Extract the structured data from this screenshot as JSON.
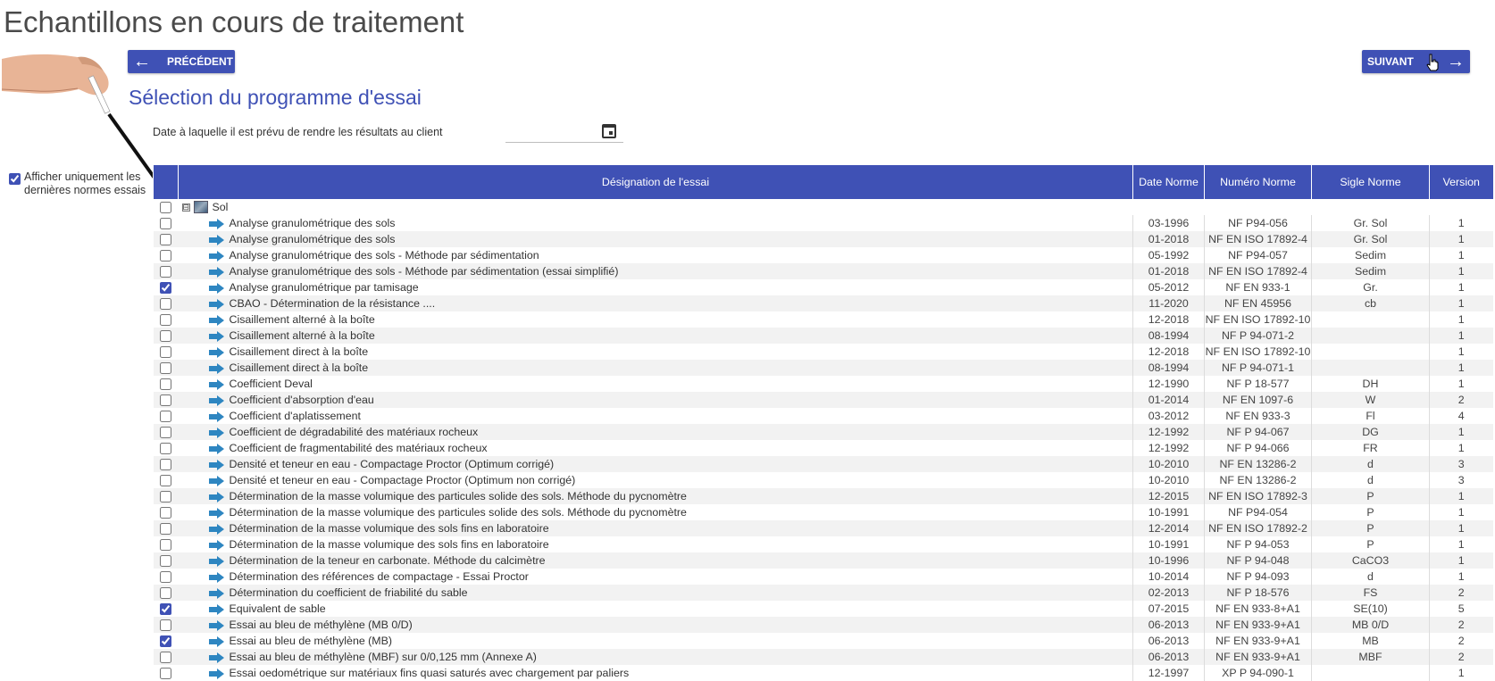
{
  "page": {
    "title": "Echantillons en cours de traitement"
  },
  "nav": {
    "prev_label": "PRÉCÉDENT",
    "next_label": "SUIVANT"
  },
  "section": {
    "title": "Sélection du programme d'essai"
  },
  "date_field": {
    "label": "Date à laquelle il est prévu de rendre les résultats au client",
    "value": ""
  },
  "filter": {
    "label_line1": "Afficher uniquement les",
    "label_line2": "dernières normes essais",
    "checked": true
  },
  "table": {
    "headers": {
      "designation": "Désignation de l'essai",
      "date": "Date Norme",
      "numero": "Numéro Norme",
      "sigle": "Sigle Norme",
      "version": "Version"
    },
    "group": {
      "label": "Sol",
      "toggle": "⊟"
    },
    "rows": [
      {
        "name": "Analyse granulométrique des sols",
        "date": "03-1996",
        "numero": "NF P94-056",
        "sigle": "Gr. Sol",
        "version": "1",
        "checked": false
      },
      {
        "name": "Analyse granulométrique des sols",
        "date": "01-2018",
        "numero": "NF EN ISO 17892-4",
        "sigle": "Gr. Sol",
        "version": "1",
        "checked": false
      },
      {
        "name": "Analyse granulométrique des sols - Méthode par sédimentation",
        "date": "05-1992",
        "numero": "NF P94-057",
        "sigle": "Sedim",
        "version": "1",
        "checked": false
      },
      {
        "name": "Analyse granulométrique des sols - Méthode par sédimentation (essai simplifié)",
        "date": "01-2018",
        "numero": "NF EN ISO 17892-4",
        "sigle": "Sedim",
        "version": "1",
        "checked": false
      },
      {
        "name": "Analyse granulométrique par tamisage",
        "date": "05-2012",
        "numero": "NF EN 933-1",
        "sigle": "Gr.",
        "version": "1",
        "checked": true
      },
      {
        "name": "CBAO - Détermination de la résistance ....",
        "date": "11-2020",
        "numero": "NF EN 45956",
        "sigle": "cb",
        "version": "1",
        "checked": false
      },
      {
        "name": "Cisaillement alterné à la boîte",
        "date": "12-2018",
        "numero": "NF EN ISO 17892-10",
        "sigle": "",
        "version": "1",
        "checked": false
      },
      {
        "name": "Cisaillement alterné à la boîte",
        "date": "08-1994",
        "numero": "NF P 94-071-2",
        "sigle": "",
        "version": "1",
        "checked": false
      },
      {
        "name": "Cisaillement direct à la boîte",
        "date": "12-2018",
        "numero": "NF EN ISO 17892-10",
        "sigle": "",
        "version": "1",
        "checked": false
      },
      {
        "name": "Cisaillement direct à la boîte",
        "date": "08-1994",
        "numero": "NF P 94-071-1",
        "sigle": "",
        "version": "1",
        "checked": false
      },
      {
        "name": "Coefficient Deval",
        "date": "12-1990",
        "numero": "NF P 18-577",
        "sigle": "DH",
        "version": "1",
        "checked": false
      },
      {
        "name": "Coefficient d'absorption d'eau",
        "date": "01-2014",
        "numero": "NF EN 1097-6",
        "sigle": "W",
        "version": "2",
        "checked": false
      },
      {
        "name": "Coefficient d'aplatissement",
        "date": "03-2012",
        "numero": "NF EN 933-3",
        "sigle": "Fl",
        "version": "4",
        "checked": false
      },
      {
        "name": "Coefficient de dégradabilité des matériaux rocheux",
        "date": "12-1992",
        "numero": "NF P 94-067",
        "sigle": "DG",
        "version": "1",
        "checked": false
      },
      {
        "name": "Coefficient de fragmentabilité des matériaux rocheux",
        "date": "12-1992",
        "numero": "NF P 94-066",
        "sigle": "FR",
        "version": "1",
        "checked": false
      },
      {
        "name": "Densité et teneur en eau - Compactage Proctor (Optimum corrigé)",
        "date": "10-2010",
        "numero": "NF EN 13286-2",
        "sigle": "d",
        "version": "3",
        "checked": false
      },
      {
        "name": "Densité et teneur en eau - Compactage Proctor (Optimum non corrigé)",
        "date": "10-2010",
        "numero": "NF EN 13286-2",
        "sigle": "d",
        "version": "3",
        "checked": false
      },
      {
        "name": "Détermination de la masse volumique des particules solide des sols. Méthode du pycnomètre",
        "date": "12-2015",
        "numero": "NF EN ISO 17892-3",
        "sigle": "P",
        "version": "1",
        "checked": false
      },
      {
        "name": "Détermination de la masse volumique des particules solide des sols. Méthode du pycnomètre",
        "date": "10-1991",
        "numero": "NF P94-054",
        "sigle": "P",
        "version": "1",
        "checked": false
      },
      {
        "name": "Détermination de la masse volumique des sols fins en laboratoire",
        "date": "12-2014",
        "numero": "NF EN ISO 17892-2",
        "sigle": "P",
        "version": "1",
        "checked": false
      },
      {
        "name": "Détermination de la masse volumique des sols fins en laboratoire",
        "date": "10-1991",
        "numero": "NF P 94-053",
        "sigle": "P",
        "version": "1",
        "checked": false
      },
      {
        "name": "Détermination de la teneur en carbonate. Méthode du calcimètre",
        "date": "10-1996",
        "numero": "NF P 94-048",
        "sigle": "CaCO3",
        "version": "1",
        "checked": false
      },
      {
        "name": "Détermination des références de compactage - Essai Proctor",
        "date": "10-2014",
        "numero": "NF P 94-093",
        "sigle": "d",
        "version": "1",
        "checked": false
      },
      {
        "name": "Détermination du coefficient de friabilité du sable",
        "date": "02-2013",
        "numero": "NF P 18-576",
        "sigle": "FS",
        "version": "2",
        "checked": false
      },
      {
        "name": "Equivalent de sable",
        "date": "07-2015",
        "numero": "NF EN 933-8+A1",
        "sigle": "SE(10)",
        "version": "5",
        "checked": true
      },
      {
        "name": "Essai au bleu de méthylène (MB 0/D)",
        "date": "06-2013",
        "numero": "NF EN 933-9+A1",
        "sigle": "MB 0/D",
        "version": "2",
        "checked": false
      },
      {
        "name": "Essai au bleu de méthylène (MB)",
        "date": "06-2013",
        "numero": "NF EN 933-9+A1",
        "sigle": "MB",
        "version": "2",
        "checked": true
      },
      {
        "name": "Essai au bleu de méthylène (MBF) sur 0/0,125 mm (Annexe A)",
        "date": "06-2013",
        "numero": "NF EN 933-9+A1",
        "sigle": "MBF",
        "version": "2",
        "checked": false
      },
      {
        "name": "Essai oedométrique sur matériaux fins quasi saturés avec chargement par paliers",
        "date": "12-1997",
        "numero": "XP P 94-090-1",
        "sigle": "",
        "version": "1",
        "checked": false
      }
    ]
  },
  "colors": {
    "primary": "#3f51b5",
    "row_arrow": "#2e86c1"
  }
}
